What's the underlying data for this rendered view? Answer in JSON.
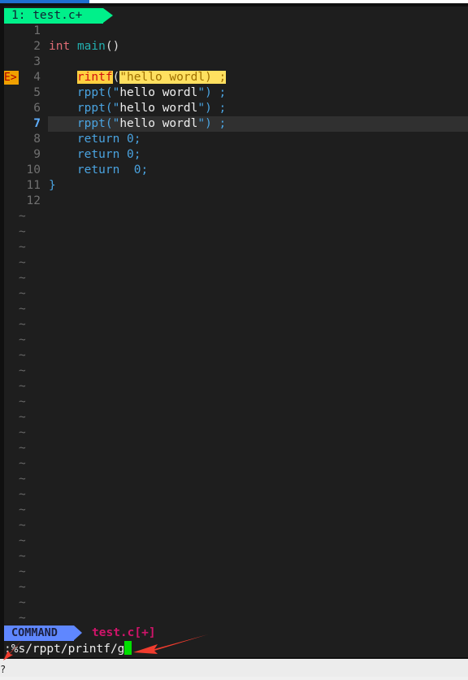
{
  "tab": {
    "label": "1: test.c+"
  },
  "lines": [
    {
      "num": "1"
    },
    {
      "num": "2",
      "parts": [
        [
          "kw",
          "int"
        ],
        [
          "pl",
          " "
        ],
        [
          "fn",
          "main"
        ],
        [
          "pl",
          "()"
        ]
      ]
    },
    {
      "num": "3"
    },
    {
      "num": "4",
      "sign": "E>",
      "parts": [
        [
          "pl",
          "    "
        ],
        [
          "err",
          "rintf"
        ],
        [
          "pl",
          "("
        ],
        [
          "errs",
          "\"hello wordl) ;"
        ]
      ]
    },
    {
      "num": "5",
      "parts": [
        [
          "pl",
          "    "
        ],
        [
          "bl",
          "rppt(\""
        ],
        [
          "wh",
          "hello wordl"
        ],
        [
          "bl",
          "\") ;"
        ]
      ]
    },
    {
      "num": "6",
      "parts": [
        [
          "pl",
          "    "
        ],
        [
          "bl",
          "rppt(\""
        ],
        [
          "wh",
          "hello wordl"
        ],
        [
          "bl",
          "\") ;"
        ]
      ]
    },
    {
      "num": "7",
      "current": true,
      "parts": [
        [
          "pl",
          "    "
        ],
        [
          "bl",
          "rppt(\""
        ],
        [
          "wh",
          "hello wordl"
        ],
        [
          "bl",
          "\") ;"
        ]
      ]
    },
    {
      "num": "8",
      "parts": [
        [
          "pl",
          "    "
        ],
        [
          "bl",
          "return 0;"
        ]
      ]
    },
    {
      "num": "9",
      "parts": [
        [
          "pl",
          "    "
        ],
        [
          "bl",
          "return 0;"
        ]
      ]
    },
    {
      "num": "10",
      "parts": [
        [
          "pl",
          "    "
        ],
        [
          "bl",
          "return  0;"
        ]
      ]
    },
    {
      "num": "11",
      "parts": [
        [
          "bl",
          "}"
        ]
      ]
    },
    {
      "num": "12"
    }
  ],
  "tilde_char": "~",
  "statusline": {
    "mode": "COMMAND",
    "filename": "test.c[+]"
  },
  "cmdline": {
    "text": ":%s/rppt/printf/g"
  },
  "below_text": "?",
  "colors": {
    "tab": "#00f08a",
    "mode": "#5f87ff",
    "filename": "#d0146a",
    "cursor": "#00e000",
    "annotation_arrow": "#f03c2e"
  }
}
